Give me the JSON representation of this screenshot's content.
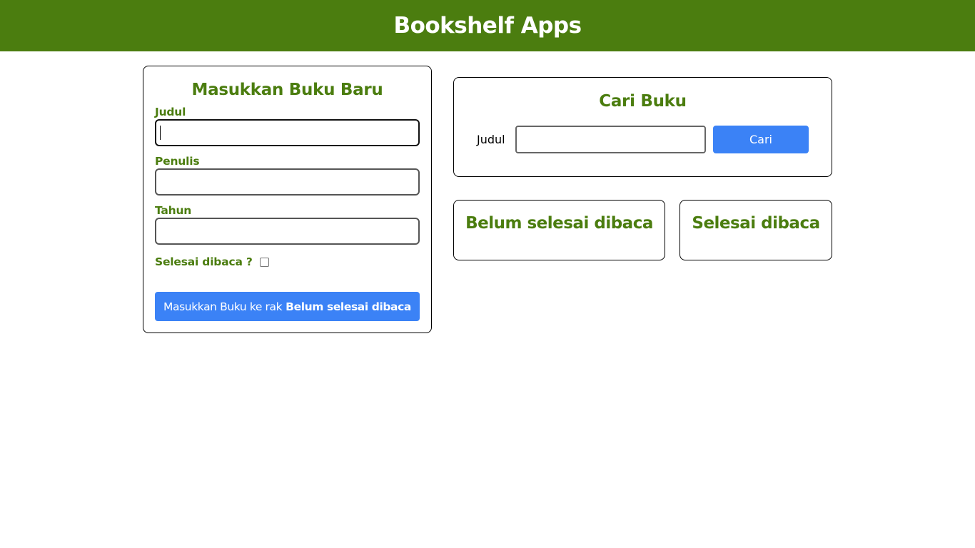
{
  "header": {
    "title": "Bookshelf Apps"
  },
  "input_section": {
    "heading": "Masukkan Buku Baru",
    "title_label": "Judul",
    "title_value": "",
    "author_label": "Penulis",
    "author_value": "",
    "year_label": "Tahun",
    "year_value": "",
    "complete_label": "Selesai dibaca ?",
    "complete_checked": false,
    "submit_label_prefix": "Masukkan Buku ke rak",
    "submit_label_shelf": "Belum selesai dibaca"
  },
  "search_section": {
    "heading": "Cari Buku",
    "title_label": "Judul",
    "title_value": "",
    "submit_label": "Cari"
  },
  "shelves": {
    "incomplete_title": "Belum selesai dibaca",
    "complete_title": "Selesai dibaca"
  },
  "colors": {
    "brand_green": "#4b7d0f",
    "button_blue": "#3b82f6",
    "header_text": "#ffffff"
  }
}
